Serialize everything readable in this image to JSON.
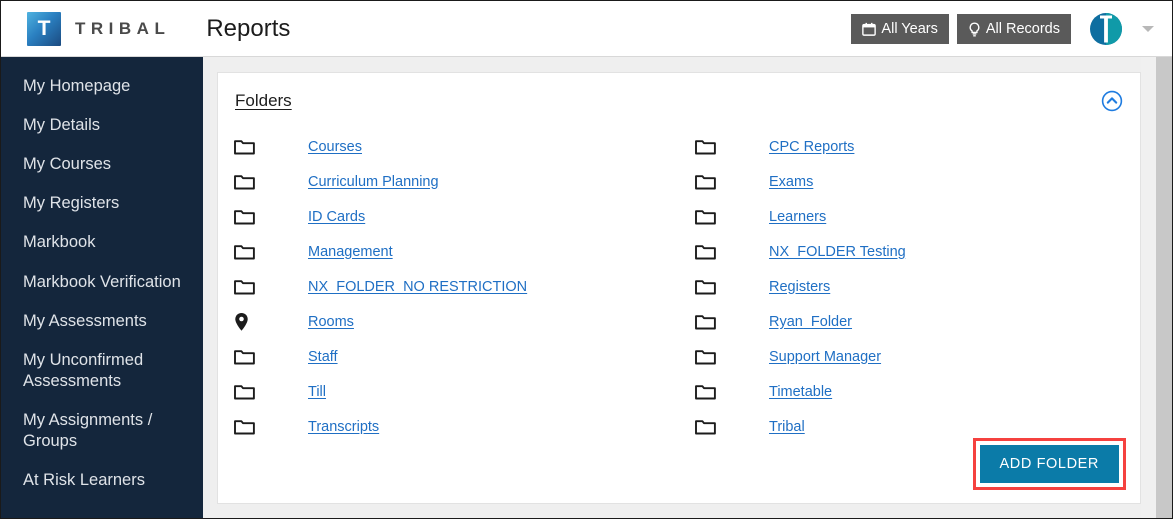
{
  "header": {
    "logo_letter": "T",
    "brand": "TRIBAL",
    "page_title": "Reports",
    "buttons": [
      {
        "label": "All Years",
        "icon": "calendar-icon"
      },
      {
        "label": "All Records",
        "icon": "lightbulb-icon"
      }
    ],
    "avatar_icon": "tribal-shield-avatar",
    "caret_icon": "chevron-down-icon"
  },
  "sidebar": {
    "items": [
      {
        "label": "My Homepage"
      },
      {
        "label": "My Details"
      },
      {
        "label": "My Courses"
      },
      {
        "label": "My Registers"
      },
      {
        "label": "Markbook"
      },
      {
        "label": "Markbook Verification"
      },
      {
        "label": "My Assessments"
      },
      {
        "label": "My Unconfirmed Assessments"
      },
      {
        "label": "My Assignments / Groups"
      },
      {
        "label": "At Risk Learners"
      }
    ]
  },
  "panel": {
    "title": "Folders",
    "collapse_icon": "chevron-up-circle-icon",
    "add_folder_label": "ADD FOLDER",
    "left_column": [
      {
        "label": "Courses",
        "icon": "folder-icon"
      },
      {
        "label": "Curriculum Planning",
        "icon": "folder-icon"
      },
      {
        "label": "ID Cards",
        "icon": "folder-icon"
      },
      {
        "label": "Management",
        "icon": "folder-icon"
      },
      {
        "label": "NX_FOLDER_NO RESTRICTION",
        "icon": "folder-icon"
      },
      {
        "label": "Rooms",
        "icon": "map-pin-icon"
      },
      {
        "label": "Staff",
        "icon": "folder-icon"
      },
      {
        "label": "Till",
        "icon": "folder-icon"
      },
      {
        "label": "Transcripts",
        "icon": "folder-icon"
      }
    ],
    "right_column": [
      {
        "label": "CPC Reports",
        "icon": "folder-icon"
      },
      {
        "label": "Exams",
        "icon": "folder-icon"
      },
      {
        "label": "Learners",
        "icon": "folder-icon"
      },
      {
        "label": "NX_FOLDER Testing",
        "icon": "folder-icon"
      },
      {
        "label": "Registers",
        "icon": "folder-icon"
      },
      {
        "label": "Ryan_Folder",
        "icon": "folder-icon"
      },
      {
        "label": "Support Manager",
        "icon": "folder-icon"
      },
      {
        "label": "Timetable",
        "icon": "folder-icon"
      },
      {
        "label": "Tribal",
        "icon": "folder-icon"
      }
    ]
  },
  "colors": {
    "sidebar_bg": "#14263c",
    "link_blue": "#1f6fc4",
    "button_blue": "#0b7ba8",
    "highlight_red": "#f5413f",
    "header_btn_gray": "#5a5a5a"
  }
}
